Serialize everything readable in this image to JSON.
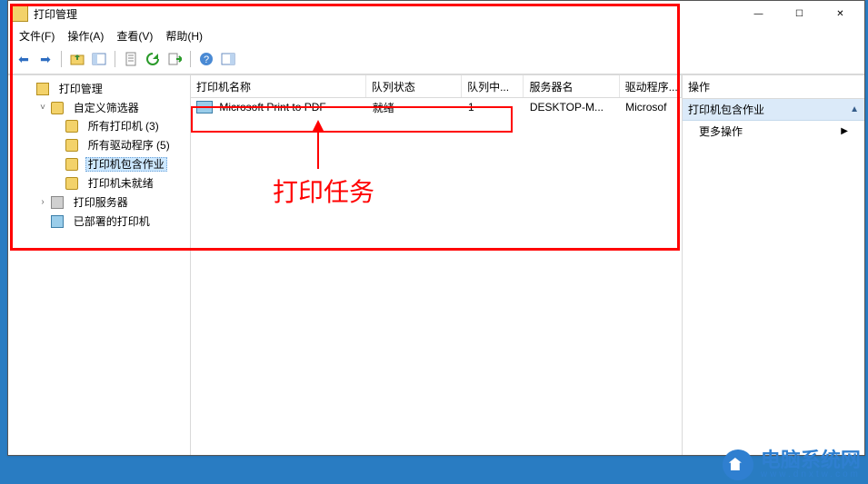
{
  "window": {
    "title": "打印管理",
    "minimize": "—",
    "maximize": "☐",
    "close": "✕"
  },
  "menu": {
    "file": "文件(F)",
    "action": "操作(A)",
    "view": "查看(V)",
    "help": "帮助(H)"
  },
  "tree": {
    "root": "打印管理",
    "custom_filters": "自定义筛选器",
    "all_printers": "所有打印机 (3)",
    "all_drivers": "所有驱动程序 (5)",
    "printers_with_jobs": "打印机包含作业",
    "printers_not_ready": "打印机未就绪",
    "print_servers": "打印服务器",
    "deployed_printers": "已部署的打印机"
  },
  "table": {
    "cols": {
      "name": "打印机名称",
      "status": "队列状态",
      "jobs": "队列中...",
      "server": "服务器名",
      "driver": "驱动程序..."
    },
    "row0": {
      "name": "Microsoft Print to PDF",
      "status": "就绪",
      "jobs": "1",
      "server": "DESKTOP-M...",
      "driver": "Microsof"
    }
  },
  "actions": {
    "header": "操作",
    "group": "打印机包含作业",
    "more": "更多操作"
  },
  "annotation": {
    "label": "打印任务"
  },
  "watermark": {
    "main": "电脑系统网",
    "sub": "www.dnxtw.com"
  }
}
